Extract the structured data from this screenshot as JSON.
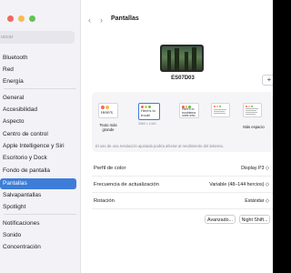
{
  "window": {
    "traffic_lights": [
      "#ee6a5f",
      "#f5bd4f",
      "#61c454"
    ]
  },
  "sidebar": {
    "search_placeholder": "uscar",
    "items": [
      {
        "label": "Bluetooth",
        "icon": "bluetooth-icon",
        "active": false
      },
      {
        "label": "Red",
        "icon": "network-icon",
        "active": false
      },
      {
        "label": "Energía",
        "icon": "battery-icon",
        "active": false
      },
      {
        "label": "General",
        "icon": "gear-icon",
        "active": false
      },
      {
        "label": "Accesibilidad",
        "icon": "accessibility-icon",
        "active": false
      },
      {
        "label": "Aspecto",
        "icon": "appearance-icon",
        "active": false
      },
      {
        "label": "Centro de control",
        "icon": "control-center-icon",
        "active": false
      },
      {
        "label": "Apple Intelligence y Siri",
        "icon": "siri-icon",
        "active": false
      },
      {
        "label": "Escritorio y Dock",
        "icon": "dock-icon",
        "active": false
      },
      {
        "label": "Fondo de pantalla",
        "icon": "wallpaper-icon",
        "active": false
      },
      {
        "label": "Pantallas",
        "icon": "display-icon",
        "active": true
      },
      {
        "label": "Salvapantallas",
        "icon": "screensaver-icon",
        "active": false
      },
      {
        "label": "Spotlight",
        "icon": "spotlight-icon",
        "active": false
      },
      {
        "label": "Notificaciones",
        "icon": "notifications-icon",
        "active": false
      },
      {
        "label": "Sonido",
        "icon": "sound-icon",
        "active": false
      },
      {
        "label": "Concentración",
        "icon": "focus-icon",
        "active": false
      }
    ]
  },
  "header": {
    "back_icon": "chevron-left-icon",
    "forward_icon": "chevron-right-icon",
    "title": "Pantallas"
  },
  "display": {
    "name": "ES07D03",
    "add_label": "+"
  },
  "resolutions": {
    "options": [
      {
        "label": "Texto más grande",
        "thumb_text": "Here's",
        "selected": false
      },
      {
        "label": "",
        "thumb_text": "Here's to troubl",
        "selected": true,
        "size_text": "3360 × 1440"
      },
      {
        "label": "",
        "thumb_text": "Here's to troublema ones who",
        "selected": false
      },
      {
        "label": "",
        "thumb_text": "",
        "selected": false
      },
      {
        "label": "Más espacio",
        "thumb_text": "",
        "selected": false
      }
    ],
    "note": "El uso de una resolución ajustada podría afectar al rendimiento del sistema."
  },
  "settings": [
    {
      "label": "Perfil de color",
      "value": "Display P3 ◇"
    },
    {
      "label": "Frecuencia de actualización",
      "value": "Variable (48–144 hercios) ◇"
    },
    {
      "label": "Rotación",
      "value": "Estándar ◇"
    }
  ],
  "buttons": {
    "advanced": "Avanzado...",
    "night_shift": "Night Shift..."
  },
  "colors": {
    "accent": "#3d7dd8"
  }
}
